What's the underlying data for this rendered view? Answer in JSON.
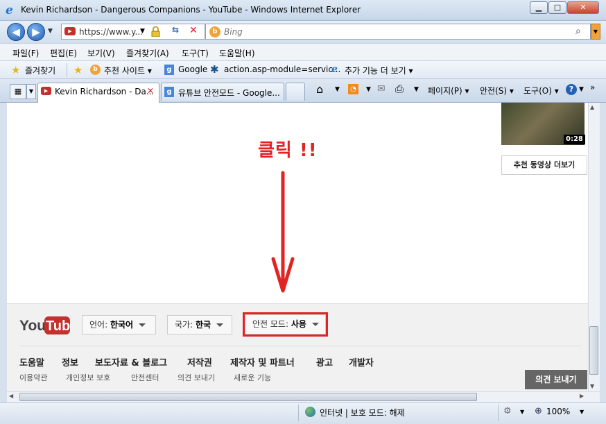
{
  "window": {
    "title": "Kevin Richardson - Dangerous Companions - YouTube - Windows Internet Explorer",
    "btn_min": "▁",
    "btn_max": "□",
    "btn_close": "✕"
  },
  "address": {
    "url": "https://www.y...",
    "search_placeholder": "Bing"
  },
  "menu": [
    "파일(F)",
    "편집(E)",
    "보기(V)",
    "즐겨찾기(A)",
    "도구(T)",
    "도움말(H)"
  ],
  "favorites": {
    "label": "즐겨찾기",
    "items": [
      "추천 사이트 ▾",
      "Google",
      "action.asp-module=servic...",
      "추가 기능 더 보기 ▾"
    ]
  },
  "tabs": [
    "Kevin Richardson - Da...",
    "유튜브 안전모드 - Google..."
  ],
  "toolbar": {
    "page": "페이지(P) ▾",
    "safety": "안전(S) ▾",
    "tools": "도구(O) ▾",
    "help": "?"
  },
  "sidebar_video": {
    "duration": "0:28",
    "more_button": "추천 동영상 더보기"
  },
  "annotation": {
    "text": "클릭 !!",
    "color": "#e22323"
  },
  "footer": {
    "logo_you": "You",
    "logo_tube": "Tube",
    "language_label": "언어:",
    "language_value": "한국어",
    "country_label": "국가:",
    "country_value": "한국",
    "safety_label": "안전 모드:",
    "safety_value": "사용",
    "links": [
      "도움말",
      "정보",
      "보도자료 & 블로그",
      "저작권",
      "제작자 및 파트너",
      "광고",
      "개발자"
    ],
    "sub_links": [
      "이용약관",
      "개인정보 보호",
      "안전센터",
      "의견 보내기",
      "새로운 기능"
    ],
    "feedback_button": "의견 보내기"
  },
  "status": {
    "zone": "인터넷 | 보호 모드: 해제",
    "zoom": "100%"
  }
}
